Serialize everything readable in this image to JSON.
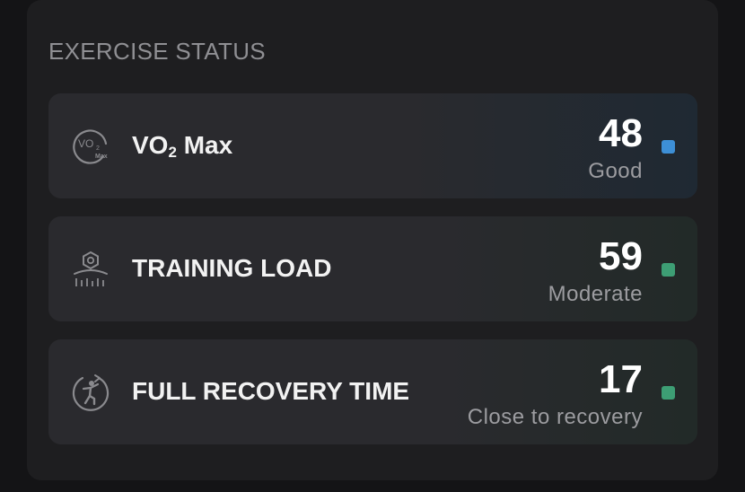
{
  "section": {
    "title": "EXERCISE STATUS"
  },
  "cards": [
    {
      "label_main": "VO",
      "label_sub": "2",
      "label_rest": " Max",
      "value": "48",
      "status": "Good",
      "status_color": "#3d8fd6",
      "icon": "vo2-max-icon",
      "icon_text_top": "VO",
      "icon_text_sub": "2",
      "icon_text_small": "Max"
    },
    {
      "label": "TRAINING LOAD",
      "value": "59",
      "status": "Moderate",
      "status_color": "#3d9e74",
      "icon": "training-load-icon"
    },
    {
      "label": "FULL RECOVERY TIME",
      "value": "17",
      "status": "Close to recovery",
      "status_color": "#3d9e74",
      "icon": "recovery-time-icon"
    }
  ]
}
